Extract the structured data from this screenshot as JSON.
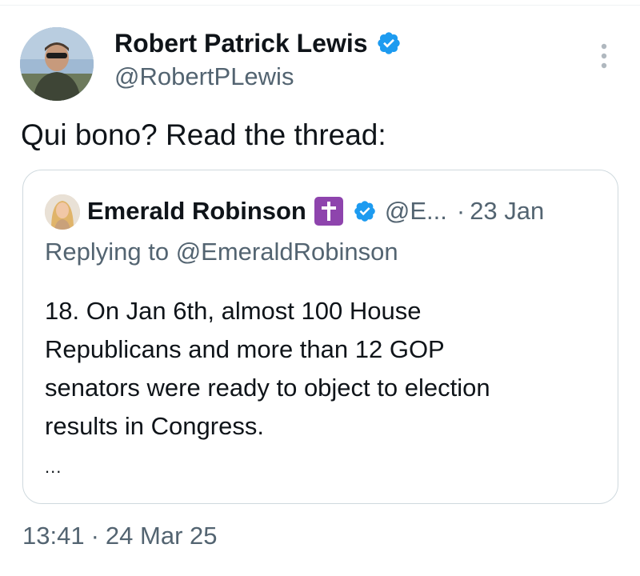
{
  "tweet": {
    "author": {
      "display_name": "Robert Patrick Lewis",
      "handle": "@RobertPLewis",
      "avatar_icon": "profile-photo",
      "verified": true
    },
    "more_icon": "more-vertical-icon",
    "text": "Qui bono? Read the thread:",
    "quoted": {
      "author": {
        "display_name": "Emerald Robinson",
        "badge_emoji": "cross-emoji",
        "verified": true,
        "handle": "@E...",
        "separator": "·",
        "date": "23 Jan"
      },
      "replying_to": "Replying to @EmeraldRobinson",
      "body_lines": [
        "18. On Jan 6th, almost 100 House",
        "Republicans and more than 12 GOP",
        "senators were ready to object to election",
        "results in Congress."
      ],
      "truncation": "..."
    },
    "timestamp": {
      "time": "13:41",
      "separator": "·",
      "date": "24 Mar 25"
    }
  },
  "colors": {
    "text_primary": "#0f1419",
    "text_secondary": "#536471",
    "verified_blue": "#1d9bf0",
    "border": "#cfd9de",
    "badge_purple": "#8e44ad"
  }
}
